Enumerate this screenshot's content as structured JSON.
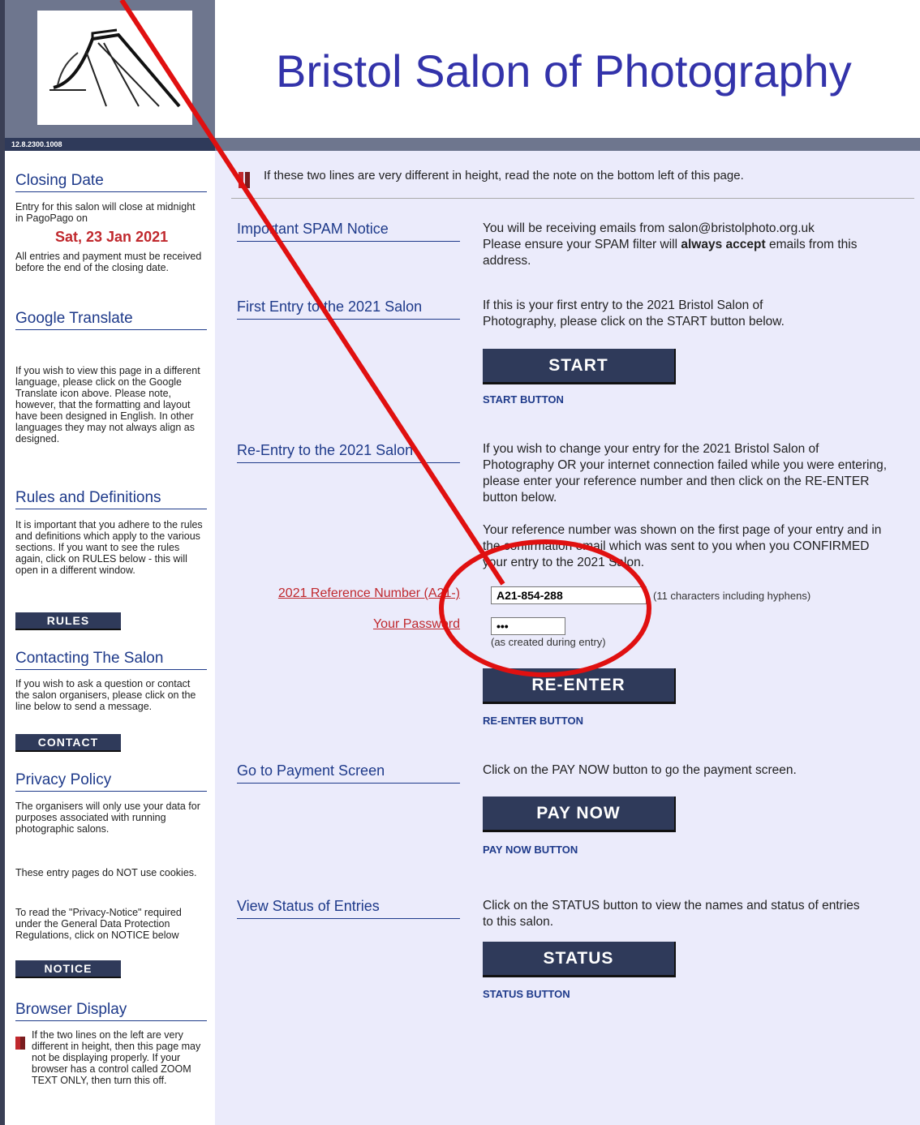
{
  "header": {
    "site_title": "Bristol Salon of Photography",
    "version": "12.8.2300.1008"
  },
  "sidebar": {
    "closing": {
      "heading": "Closing Date",
      "text_before": "Entry for this salon will close at midnight in PagoPago on",
      "date": "Sat, 23 Jan 2021",
      "text_after": "All entries and payment must be received before the end of the closing date."
    },
    "translate": {
      "heading": "Google Translate",
      "text": "If you wish to view this page in a different language, please click on the Google Translate icon above. Please note, however, that the formatting and layout have been designed in English. In other languages they may not always align as designed."
    },
    "rules": {
      "heading": "Rules and Definitions",
      "text": "It is important that you adhere to the rules and definitions which apply to the various sections. If you want to see the rules again, click on RULES below - this will open in a different window.",
      "button": "RULES"
    },
    "contact": {
      "heading": "Contacting The Salon",
      "text": "If you wish to ask a question or contact the salon organisers, please click on the line below to send a message.",
      "button": "CONTACT"
    },
    "privacy": {
      "heading": "Privacy Policy",
      "text1": "The organisers will only use your data for purposes associated with running photographic salons.",
      "text2": "These entry pages do NOT use cookies.",
      "text3": "To read the \"Privacy-Notice\" required under the General Data Protection Regulations, click on NOTICE below",
      "button": "NOTICE"
    },
    "browser": {
      "heading": "Browser Display",
      "text": "If the two lines on the left are very different in height, then this page may not be displaying properly. If your browser has a control called ZOOM TEXT ONLY, then turn this off."
    }
  },
  "main": {
    "note": "If these two lines are very different in height, read the note on the bottom left of this page.",
    "spam": {
      "label": "Important SPAM Notice",
      "text1": "You will be receiving emails from  salon@bristolphoto.org.uk",
      "text2_pre": "Please ensure your SPAM filter will ",
      "text2_bold": "always accept",
      "text2_post": " emails from this address."
    },
    "first_entry": {
      "label": "First Entry to the 2021 Salon",
      "text": "If this is your first entry to the 2021 Bristol Salon of Photography, please click on the START button below.",
      "button": "START",
      "caption": "START BUTTON"
    },
    "re_entry": {
      "label": "Re-Entry to the 2021 Salon",
      "text1": "If you wish to change your entry for the 2021 Bristol Salon of Photography OR your internet connection failed while you were entering, please enter your reference number and then click on the RE-ENTER button below.",
      "text2": "Your reference number was shown on the first page of your entry and in the confirmation email which was sent to you when you CONFIRMED your entry to the 2021 Salon.",
      "ref_label": "2021 Reference Number (A21-)",
      "ref_value": "A21-854-288",
      "ref_hint": "(11 characters including hyphens)",
      "pw_label": "Your Password",
      "pw_value": "•••",
      "pw_hint": "(as created during entry)",
      "button": "RE-ENTER",
      "caption": "RE-ENTER BUTTON"
    },
    "payment": {
      "label": "Go to Payment Screen",
      "text": "Click on the PAY NOW button to go the payment screen.",
      "button": "PAY NOW",
      "caption": "PAY NOW BUTTON"
    },
    "status": {
      "label": "View Status of Entries",
      "text": "Click on the STATUS button to view the names and status of entries to this salon.",
      "button": "STATUS",
      "caption": "STATUS BUTTON"
    }
  },
  "colors": {
    "title_blue": "#3333aa",
    "heading_blue": "#1e3a8a",
    "accent_red": "#c0282d",
    "button_navy": "#2f3a5a",
    "main_bg": "#ebebfb",
    "annotation_red": "#e01010"
  }
}
